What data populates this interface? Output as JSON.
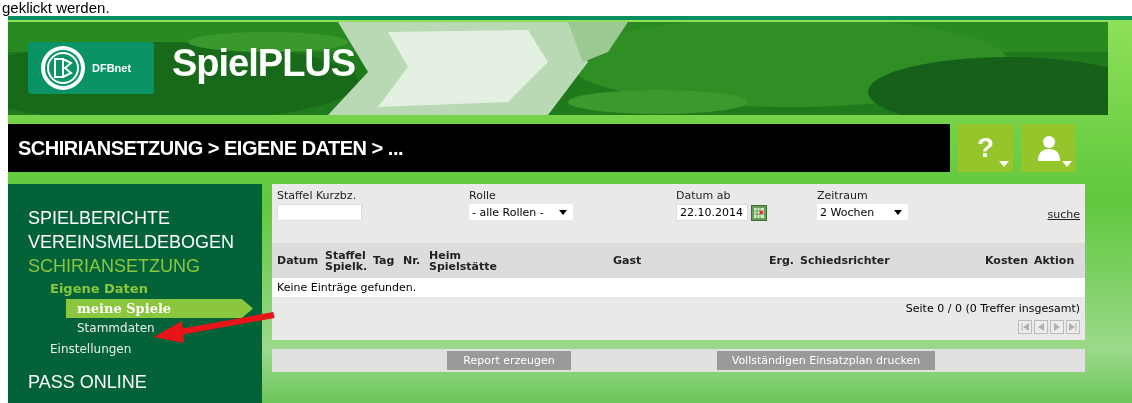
{
  "caption": "geklickt werden.",
  "header": {
    "logo_text": "DFBnet",
    "title": "SpielPLUS"
  },
  "breadcrumb": "SCHIRIANSETZUNG > EIGENE DATEN > ...",
  "header_buttons": [
    {
      "kind": "help",
      "label": "?"
    },
    {
      "kind": "user"
    }
  ],
  "sidebar": {
    "items": [
      {
        "label": "SPIELBERICHTE",
        "selected": false
      },
      {
        "label": "VEREINSMELDEBOGEN",
        "selected": false
      },
      {
        "label": "SCHIRIANSETZUNG",
        "selected": true,
        "children": [
          {
            "label": "Eigene Daten",
            "selected": true,
            "children": [
              {
                "label": "meine Spiele",
                "selected": true
              },
              {
                "label": "Stammdaten",
                "selected": false
              }
            ]
          },
          {
            "label": "Einstellungen",
            "selected": false
          }
        ]
      },
      {
        "label": "PASS ONLINE",
        "selected": false
      }
    ]
  },
  "filters": [
    {
      "kind": "text",
      "label": "Staffel Kurzbz."
    },
    {
      "kind": "select",
      "label": "Rolle",
      "value": "- alle Rollen -"
    },
    {
      "kind": "date",
      "label": "Datum ab",
      "value": "22.10.2014"
    },
    {
      "kind": "select",
      "label": "Zeitraum",
      "value": "2 Wochen"
    }
  ],
  "search_link": "suche",
  "table": {
    "columns": [
      "Datum",
      "Staffel\nSpielk.",
      "Tag",
      "Nr.",
      "Heim\nSpielstätte",
      "Gast",
      "Erg.",
      "Schiedsrichter",
      "Kosten",
      "Aktion"
    ],
    "empty_message": "Keine Einträge gefunden."
  },
  "pagination": {
    "summary": "Seite 0 / 0 (0 Treffer insgesamt)",
    "buttons": [
      {
        "kind": "first",
        "disabled": true
      },
      {
        "kind": "prev",
        "disabled": true
      },
      {
        "kind": "next",
        "disabled": true
      },
      {
        "kind": "last",
        "disabled": true
      }
    ]
  },
  "actions": [
    "Report erzeugen",
    "Vollständigen Einsatzplan drucken"
  ],
  "annotation": {
    "kind": "arrow"
  }
}
